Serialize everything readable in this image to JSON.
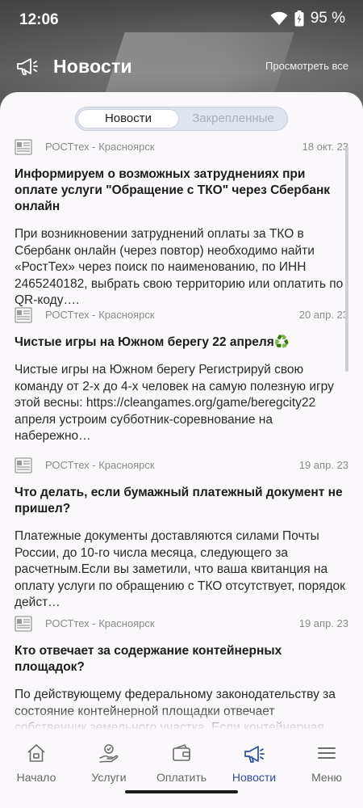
{
  "status_bar": {
    "time": "12:06",
    "battery": "95 %"
  },
  "header": {
    "title": "Новости",
    "view_all": "Просмотреть все"
  },
  "segment": {
    "tabs": [
      "Новости",
      "Закрепленные"
    ],
    "active": 0
  },
  "news": [
    {
      "source": "РОСТтех - Красноярск",
      "date": "18 окт. 23",
      "title": "Информируем о возможных затруднениях при оплате услуги \"Обращение с ТКО\" через Сбербанк онлайн",
      "body": "При возникновении затруднений оплаты за ТКО в Сбербанк онлайн (через повтор) необходимо найти «РостТех» через поиск по наименованию, по ИНН 2465240182, выбрать свою территорию или оплатить по QR-коду…."
    },
    {
      "source": "РОСТтех - Красноярск",
      "date": "20 апр. 23",
      "title": "Чистые игры на Южном берегу 22 апреля♻️",
      "body": "Чистые игры на Южном берегу Регистрируй свою команду от 2-х до 4-х человек на самую полезную игру этой весны: https://cleangames.org/game/beregcity22 апреля устроим субботник-соревнование на набережно…"
    },
    {
      "source": "РОСТтех - Красноярск",
      "date": "19 апр. 23",
      "title": "Что делать, если бумажный платежный документ не пришел?",
      "body": "Платежные документы доставляются силами Почты России, до 10-го числа месяца, следующего за расчетным.Если вы заметили, что ваша квитанция на оплату услуги по обращению с ТКО отсутствует, порядок дейст…"
    },
    {
      "source": "РОСТтех - Красноярск",
      "date": "19 апр. 23",
      "title": "Кто отвечает за содержание контейнерных площадок?",
      "body": "По действующему федеральному законодательству за состояние контейнерной площадки отвечает собственник земельного участка. Если контейнерная"
    }
  ],
  "bottom_nav": {
    "items": [
      {
        "label": "Начало",
        "icon": "home-icon"
      },
      {
        "label": "Услуги",
        "icon": "services-hand-icon"
      },
      {
        "label": "Оплатить",
        "icon": "wallet-icon"
      },
      {
        "label": "Новости",
        "icon": "megaphone-icon"
      },
      {
        "label": "Меню",
        "icon": "menu-icon"
      }
    ],
    "active": 3
  },
  "colors": {
    "accent": "#2c4f9e",
    "sheet": "#fbf8fc",
    "muted": "#8a8a8a"
  }
}
